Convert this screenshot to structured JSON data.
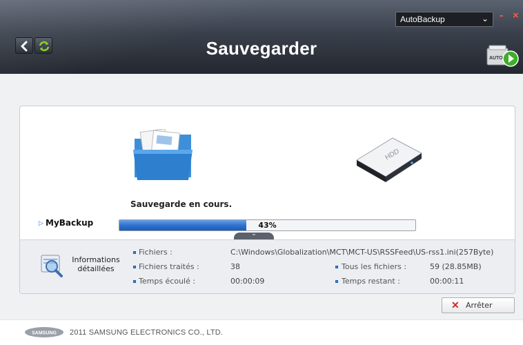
{
  "header": {
    "title": "Sauvegarder",
    "mode_select": "AutoBackup",
    "minimize_label": "-",
    "close_label": "×",
    "auto_icon_label": "AUTO",
    "back_icon": "back-arrow-icon",
    "refresh_icon": "refresh-icon"
  },
  "main": {
    "source_icon": "folder-icon",
    "target_icon": "hdd-icon",
    "hdd_label": "HDD",
    "status": "Sauvegarde en cours.",
    "job_name": "MyBackup",
    "progress_percent": 43,
    "progress_text": "43%"
  },
  "details": {
    "label": "Informations détaillées",
    "files_label": "Fichiers :",
    "files_value": "C:\\Windows\\Globalization\\MCT\\MCT-US\\RSSFeed\\US-rss1.ini(257Byte)",
    "processed_label": "Fichiers traités :",
    "processed_value": "38",
    "all_files_label": "Tous les fichiers :",
    "all_files_value": "59 (28.85MB)",
    "elapsed_label": "Temps écoulé :",
    "elapsed_value": "00:00:09",
    "remaining_label": "Temps restant :",
    "remaining_value": "00:00:11"
  },
  "actions": {
    "stop_label": "Arrêter"
  },
  "footer": {
    "logo": "SAMSUNG",
    "copyright": "2011 SAMSUNG ELECTRONICS CO., LTD."
  },
  "colors": {
    "accent": "#2f72cf",
    "stop": "#d3262a",
    "header_dark": "#23272f"
  }
}
